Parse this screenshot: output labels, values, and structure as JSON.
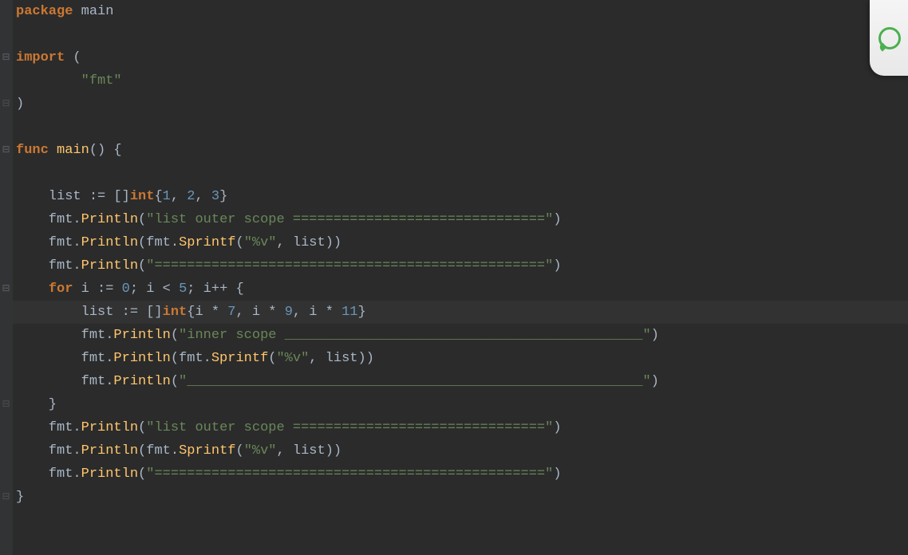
{
  "code": {
    "lines": [
      {
        "html": "<span class='kw'>package</span> <span class='ident'>main</span>"
      },
      {
        "html": ""
      },
      {
        "html": "<span class='kw'>import</span> ("
      },
      {
        "html": "        <span class='str'>\"fmt\"</span>"
      },
      {
        "html": ")"
      },
      {
        "html": ""
      },
      {
        "html": "<span class='kw'>func</span> <span class='fn'>main</span>() {"
      },
      {
        "html": ""
      },
      {
        "html": "    list := []<span class='kw'>int</span>{<span class='num'>1</span>, <span class='num'>2</span>, <span class='num'>3</span>}"
      },
      {
        "html": "    fmt.<span class='fn'>Println</span>(<span class='str'>\"list outer scope ===============================\"</span>)"
      },
      {
        "html": "    fmt.<span class='fn'>Println</span>(fmt.<span class='fn'>Sprintf</span>(<span class='str'>\"%v\"</span>, list))"
      },
      {
        "html": "    fmt.<span class='fn'>Println</span>(<span class='str'>\"================================================\"</span>)"
      },
      {
        "html": "    <span class='kw'>for</span> i := <span class='num'>0</span>; i &lt; <span class='num'>5</span>; i++ {"
      },
      {
        "html": "        list := []<span class='kw'>int</span>{i * <span class='num'>7</span>, i * <span class='num'>9</span>, i * <span class='num'>11</span>}",
        "hl": true
      },
      {
        "html": "        fmt.<span class='fn'>Println</span>(<span class='str'>\"inner scope ____________________________________________\"</span>)"
      },
      {
        "html": "        fmt.<span class='fn'>Println</span>(fmt.<span class='fn'>Sprintf</span>(<span class='str'>\"%v\"</span>, list))"
      },
      {
        "html": "        fmt.<span class='fn'>Println</span>(<span class='str'>\"________________________________________________________\"</span>)"
      },
      {
        "html": "    }"
      },
      {
        "html": "    fmt.<span class='fn'>Println</span>(<span class='str'>\"list outer scope ===============================\"</span>)"
      },
      {
        "html": "    fmt.<span class='fn'>Println</span>(fmt.<span class='fn'>Sprintf</span>(<span class='str'>\"%v\"</span>, list))"
      },
      {
        "html": "    fmt.<span class='fn'>Println</span>(<span class='str'>\"================================================\"</span>)"
      },
      {
        "html": "}"
      }
    ]
  },
  "folds": [
    {
      "line": 3,
      "type": "minus"
    },
    {
      "line": 5,
      "type": "end"
    },
    {
      "line": 7,
      "type": "minus"
    },
    {
      "line": 13,
      "type": "minus"
    },
    {
      "line": 18,
      "type": "end"
    },
    {
      "line": 22,
      "type": "end"
    }
  ],
  "source_plain": "package main\n\nimport (\n        \"fmt\"\n)\n\nfunc main() {\n\n    list := []int{1, 2, 3}\n    fmt.Println(\"list outer scope ===============================\")\n    fmt.Println(fmt.Sprintf(\"%v\", list))\n    fmt.Println(\"================================================\")\n    for i := 0; i < 5; i++ {\n        list := []int{i * 7, i * 9, i * 11}\n        fmt.Println(\"inner scope ____________________________________________\")\n        fmt.Println(fmt.Sprintf(\"%v\", list))\n        fmt.Println(\"________________________________________________________\")\n    }\n    fmt.Println(\"list outer scope ===============================\")\n    fmt.Println(fmt.Sprintf(\"%v\", list))\n    fmt.Println(\"================================================\")\n}",
  "colors": {
    "bg": "#2b2b2b",
    "fg": "#a9b7c6",
    "keyword": "#cc7832",
    "function": "#ffc66d",
    "string": "#6a8759",
    "number": "#6897bb",
    "gutter": "#313335"
  }
}
